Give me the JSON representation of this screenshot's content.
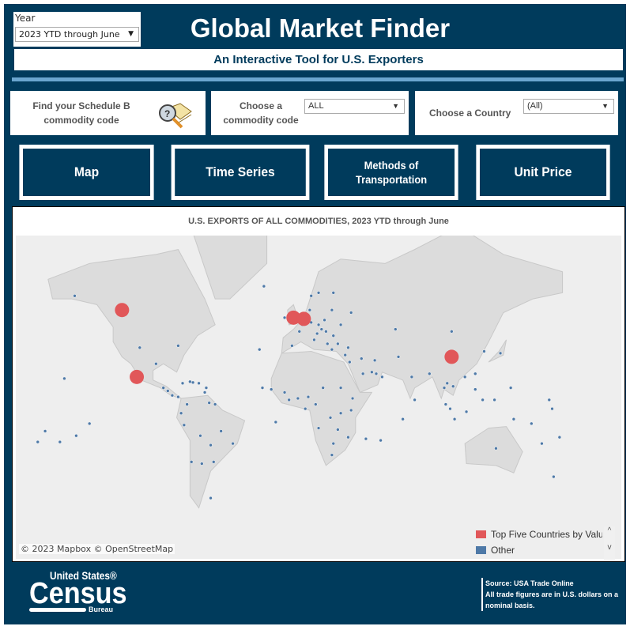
{
  "header": {
    "year_label": "Year",
    "year_value": "2023 YTD through June",
    "title": "Global Market Finder",
    "subtitle": "An Interactive Tool for U.S. Exporters"
  },
  "filters": {
    "schedule_b": "Find your Schedule B commodity code",
    "commodity_label": "Choose a commodity code",
    "commodity_value": "ALL",
    "country_label": "Choose a Country",
    "country_value": "(All)"
  },
  "nav": [
    "Map",
    "Time Series",
    "Methods of Transportation",
    "Unit Price"
  ],
  "map": {
    "title": "U.S. EXPORTS OF ALL COMMODITIES, 2023 YTD through June",
    "credit": "© 2023 Mapbox  © OpenStreetMap",
    "legend": [
      {
        "label": "Top Five Countries by Value",
        "color": "#e15759"
      },
      {
        "label": "Other",
        "color": "#4e79a7"
      }
    ],
    "top_five": [
      {
        "lon": -118,
        "lat": 56
      },
      {
        "lon": -108,
        "lat": 22
      },
      {
        "lon": -2,
        "lat": 53
      },
      {
        "lon": 5,
        "lat": 52.5
      },
      {
        "lon": 105,
        "lat": 34
      }
    ]
  },
  "footer": {
    "logo_top": "United States®",
    "logo_main": "Census",
    "logo_bottom": "Bureau",
    "source": "Source:  USA Trade Online",
    "note": "All trade figures are in U.S. dollars on a nominal basis."
  }
}
